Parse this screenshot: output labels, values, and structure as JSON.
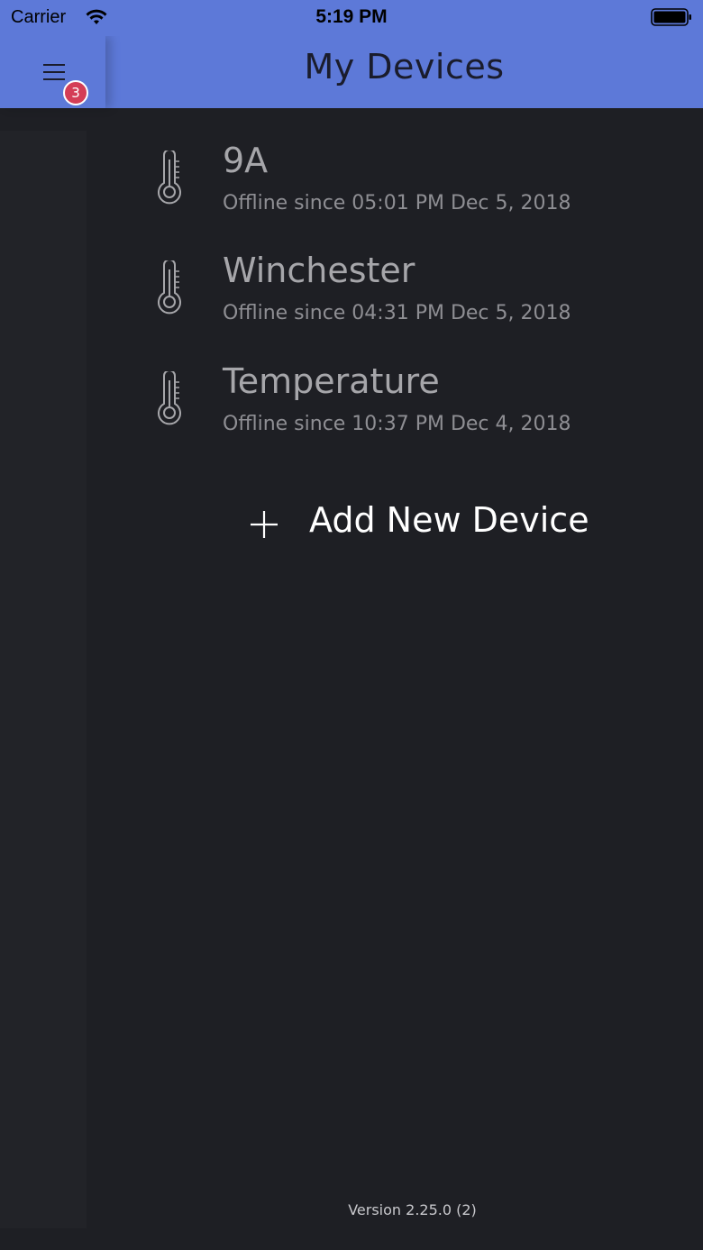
{
  "status_bar": {
    "carrier": "Carrier",
    "time": "5:19 PM"
  },
  "nav": {
    "title": "My Devices",
    "menu_icon": "hamburger-menu-icon",
    "badge_count": "3"
  },
  "devices": [
    {
      "name": "9A",
      "status": "Offline since 05:01 PM Dec 5, 2018",
      "icon": "thermometer-icon"
    },
    {
      "name": "Winchester",
      "status": "Offline since 04:31 PM Dec 5, 2018",
      "icon": "thermometer-icon"
    },
    {
      "name": "Temperature",
      "status": "Offline since 10:37 PM Dec 4, 2018",
      "icon": "thermometer-icon"
    }
  ],
  "add_device": {
    "label": "Add New Device",
    "icon": "plus-icon"
  },
  "footer": {
    "version": "Version 2.25.0 (2)"
  },
  "colors": {
    "nav_background": "#5d79d8",
    "app_background": "#1e1f24",
    "badge": "#d43d56"
  }
}
